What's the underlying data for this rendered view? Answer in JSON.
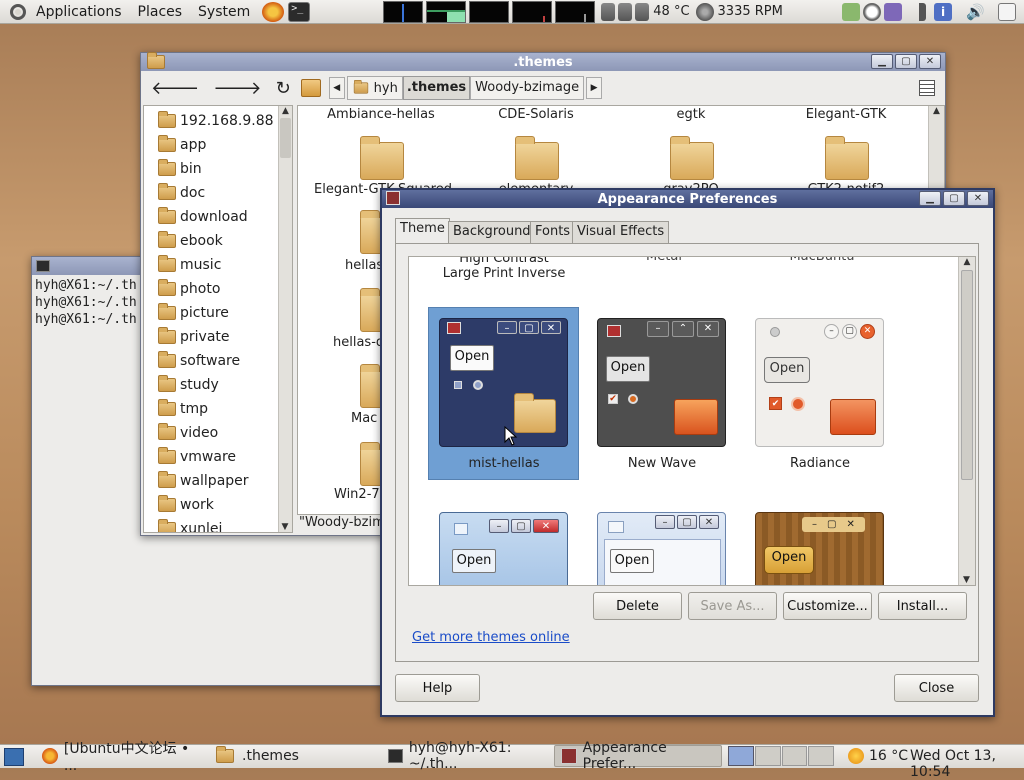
{
  "top_panel": {
    "menus": [
      "Applications",
      "Places",
      "System"
    ],
    "temperature": "48 °C",
    "fan": "3335 RPM"
  },
  "file_manager": {
    "title": ".themes",
    "path": [
      "hyh",
      ".themes",
      "Woody-bzimage"
    ],
    "sidebar": [
      "192.168.9.88",
      "app",
      "bin",
      "doc",
      "download",
      "ebook",
      "music",
      "photo",
      "picture",
      "private",
      "software",
      "study",
      "tmp",
      "video",
      "vmware",
      "wallpaper",
      "work",
      "xunlei"
    ],
    "top_labels": [
      "Ambiance-hellas",
      "CDE-Solaris",
      "egtk",
      "Elegant-GTK"
    ],
    "row2_labels": [
      "Elegant-GTK-Squared",
      "elementary",
      "gray2PO",
      "GTK2-notif2"
    ],
    "left_labels": [
      "hellas",
      "hellas-d",
      "Mac",
      "Win2-7("
    ],
    "status": "\"Woody-bzim"
  },
  "terminal": {
    "lines": [
      "hyh@X61:~/.th",
      "hyh@X61:~/.th",
      "hyh@X61:~/.th"
    ]
  },
  "appearance": {
    "title": "Appearance Preferences",
    "tabs": [
      "Theme",
      "Background",
      "Fonts",
      "Visual Effects"
    ],
    "top_partial": [
      "High Contrast Large Print Inverse",
      "Metal",
      "MacBuntu"
    ],
    "themes": [
      {
        "name": "mist-hellas",
        "selected": true
      },
      {
        "name": "New Wave"
      },
      {
        "name": "Radiance"
      }
    ],
    "preview_button": "Open",
    "buttons": {
      "delete": "Delete",
      "save_as": "Save As...",
      "customize": "Customize...",
      "install": "Install..."
    },
    "more_link": "Get more themes online",
    "help": "Help",
    "close": "Close"
  },
  "taskbar": {
    "tasks": [
      "[Ubuntu中文论坛 • ...",
      ".themes",
      "hyh@hyh-X61: ~/.th...",
      "Appearance Prefer..."
    ],
    "weather": "16 °C",
    "clock": "Wed Oct 13, 10:54"
  }
}
